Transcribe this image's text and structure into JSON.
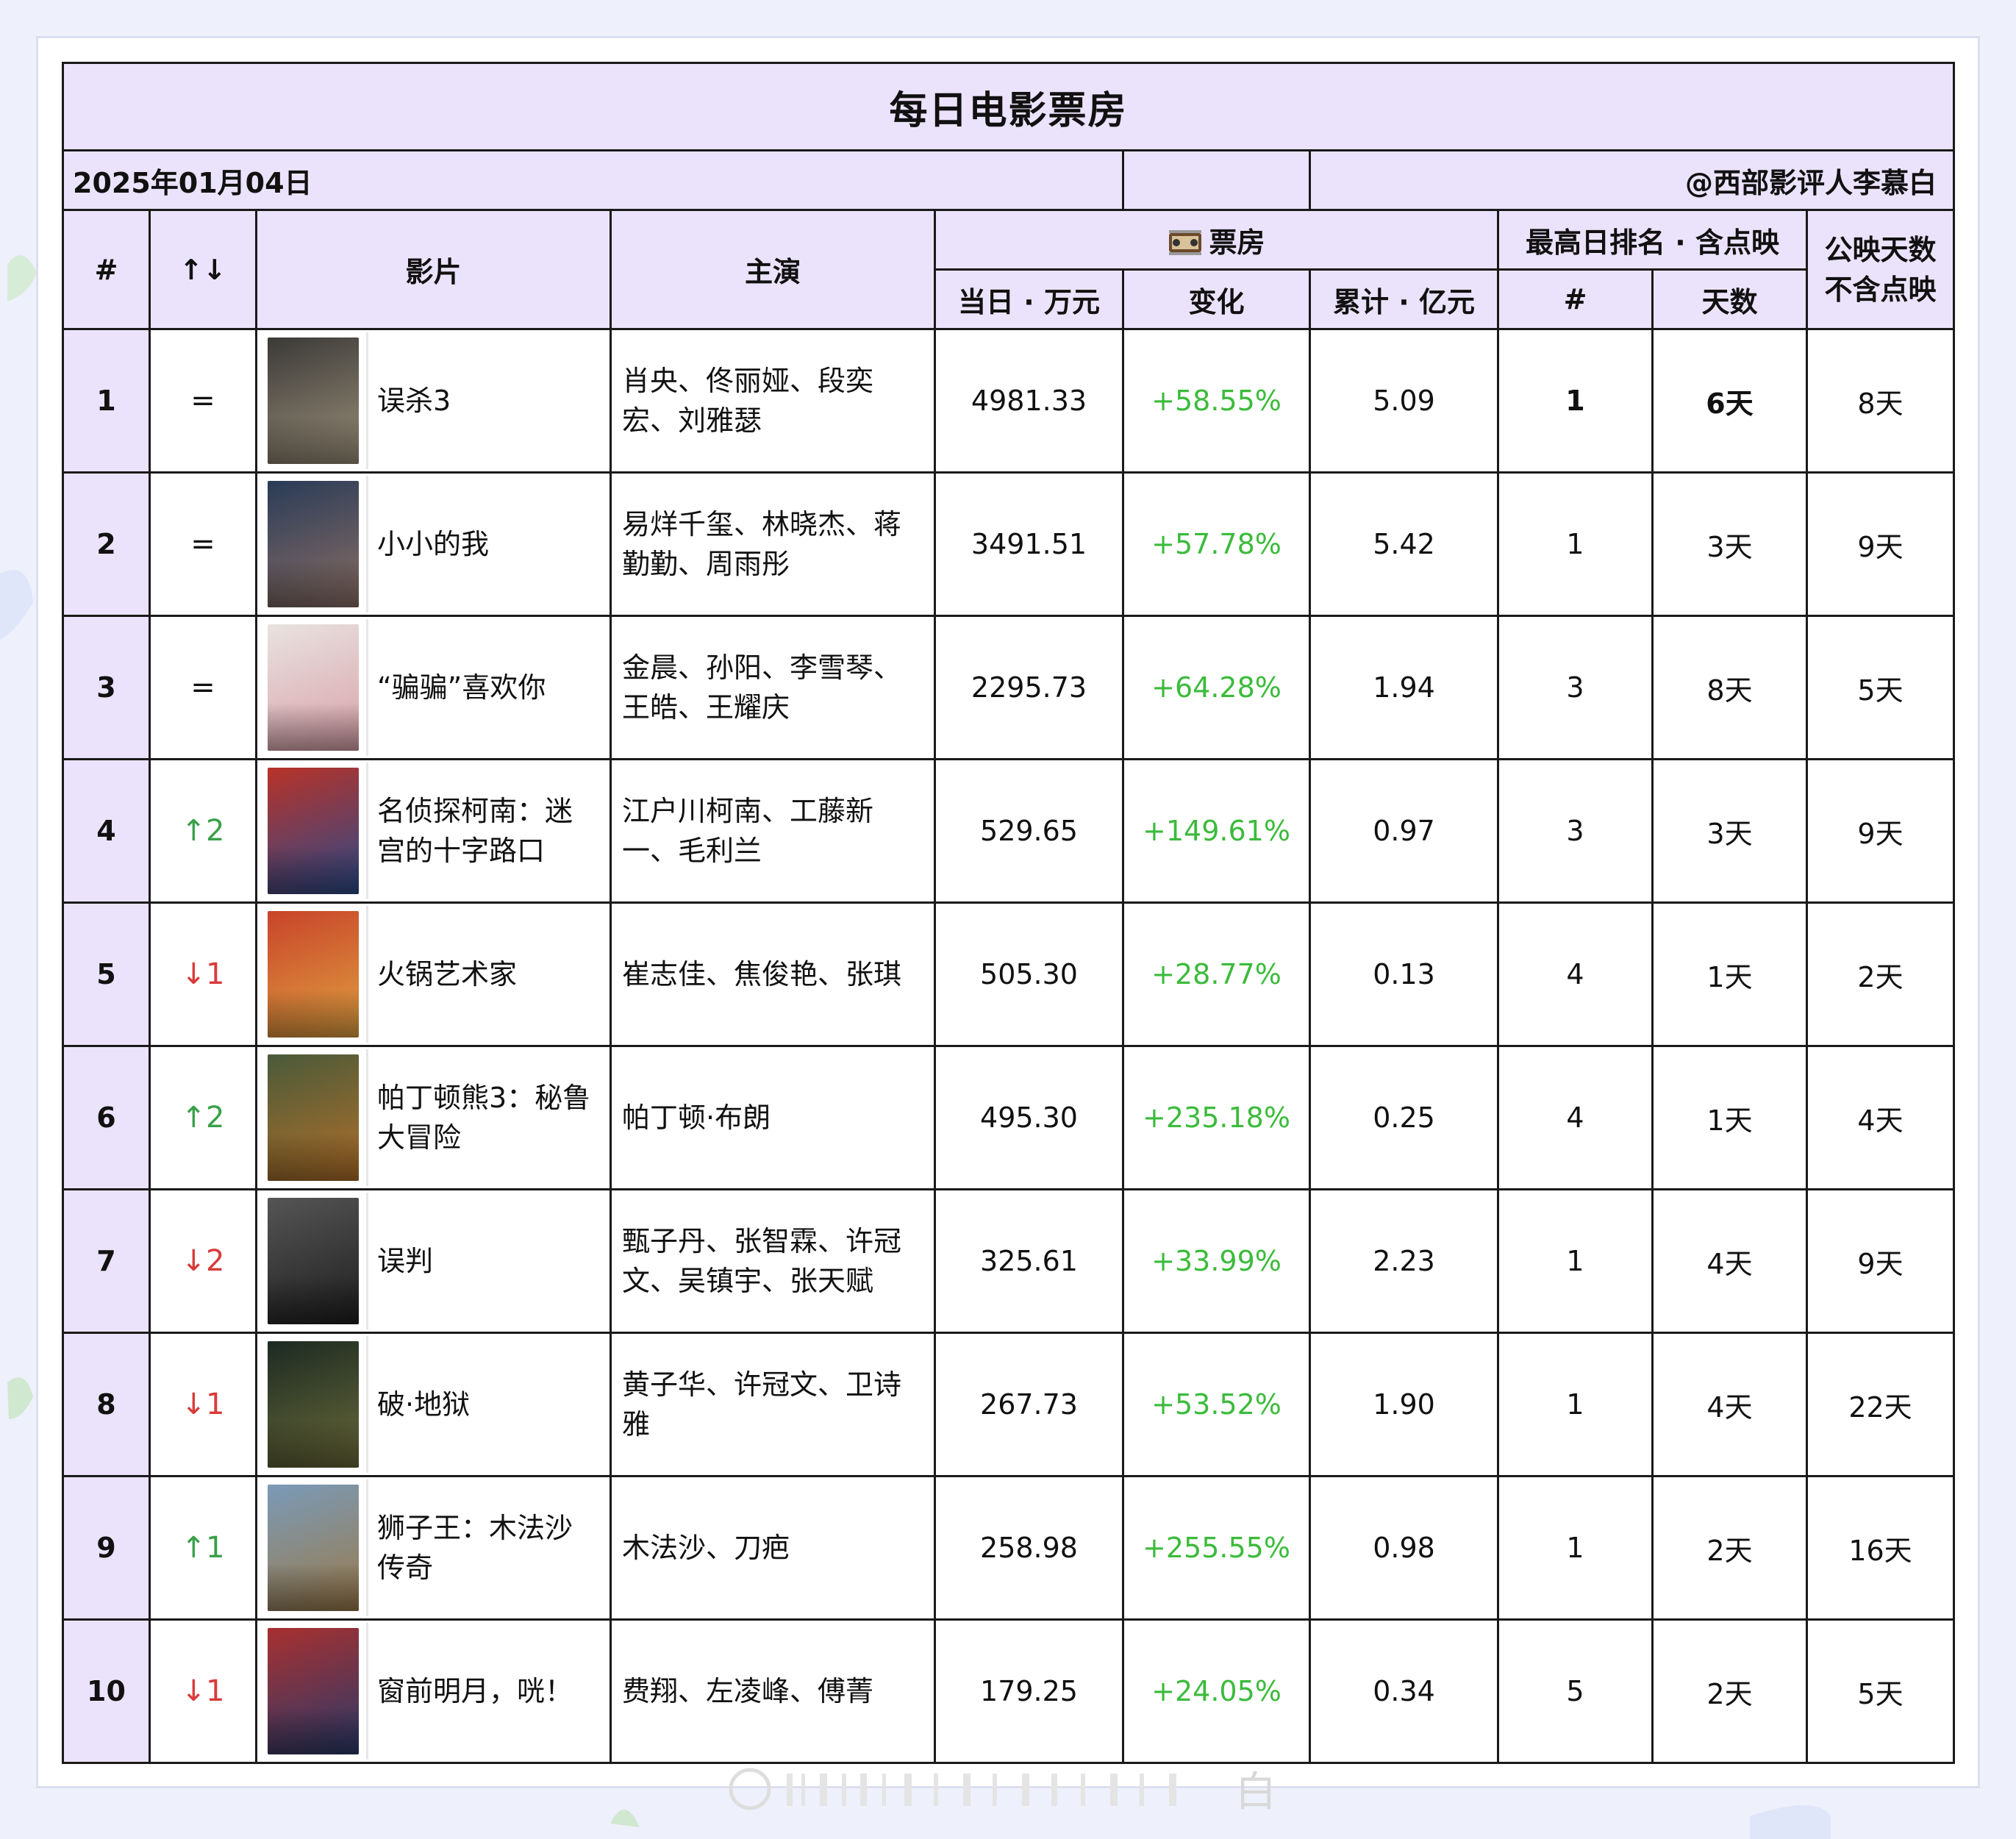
{
  "title": "每日电影票房",
  "date": "2025年01月04日",
  "author": "@西部影评人李慕白",
  "headers": {
    "rank": "#",
    "change": "↑↓",
    "movie": "影片",
    "cast": "主演",
    "box_office_group": "票房",
    "box_office_icon": "film-reel-icon",
    "daily": "当日 · 万元",
    "delta": "变化",
    "total": "累计 · 亿元",
    "peak_group": "最高日排名 · 含点映",
    "peak_rank": "#",
    "peak_days": "天数",
    "release_days_line1": "公映天数",
    "release_days_line2": "不含点映"
  },
  "rows": [
    {
      "rank": "1",
      "change": "=",
      "trend": "eq",
      "movie_line1": "误杀3",
      "movie_line2": "",
      "cast_line1": "肖央、佟丽娅、段奕",
      "cast_line2": "宏、刘雅瑟",
      "daily": "4981.33",
      "delta": "+58.55%",
      "total": "5.09",
      "peak": "1",
      "peak_days": "6天",
      "release_days": "8天",
      "poster_colors": [
        "#3b3a38",
        "#9b8f7a"
      ]
    },
    {
      "rank": "2",
      "change": "=",
      "trend": "eq",
      "movie_line1": "小小的我",
      "movie_line2": "",
      "cast_line1": "易烊千玺、林晓杰、蒋",
      "cast_line2": "勤勤、周雨彤",
      "daily": "3491.51",
      "delta": "+57.78%",
      "total": "5.42",
      "peak": "1",
      "peak_days": "3天",
      "release_days": "9天",
      "poster_colors": [
        "#2a3b57",
        "#8a6f66"
      ]
    },
    {
      "rank": "3",
      "change": "=",
      "trend": "eq",
      "movie_line1": "“骗骗”喜欢你",
      "movie_line2": "",
      "cast_line1": "金晨、孙阳、李雪琴、",
      "cast_line2": "王皓、王耀庆",
      "daily": "2295.73",
      "delta": "+64.28%",
      "total": "1.94",
      "peak": "3",
      "peak_days": "8天",
      "release_days": "5天",
      "poster_colors": [
        "#e8e3e0",
        "#d8a0a8"
      ]
    },
    {
      "rank": "4",
      "change": "↑2",
      "trend": "up",
      "movie_line1": "名侦探柯南：迷",
      "movie_line2": "宫的十字路口",
      "cast_line1": "江户川柯南、工藤新",
      "cast_line2": "一、毛利兰",
      "daily": "529.65",
      "delta": "+149.61%",
      "total": "0.97",
      "peak": "3",
      "peak_days": "3天",
      "release_days": "9天",
      "poster_colors": [
        "#b83228",
        "#2c4a8a"
      ]
    },
    {
      "rank": "5",
      "change": "↓1",
      "trend": "down",
      "movie_line1": "火锅艺术家",
      "movie_line2": "",
      "cast_line1": "崔志佳、焦俊艳、张琪",
      "cast_line2": "",
      "daily": "505.30",
      "delta": "+28.77%",
      "total": "0.13",
      "peak": "4",
      "peak_days": "1天",
      "release_days": "2天",
      "poster_colors": [
        "#c8442a",
        "#e0a040"
      ]
    },
    {
      "rank": "6",
      "change": "↑2",
      "trend": "up",
      "movie_line1": "帕丁顿熊3：秘鲁",
      "movie_line2": "大冒险",
      "cast_line1": "帕丁顿·布朗",
      "cast_line2": "",
      "daily": "495.30",
      "delta": "+235.18%",
      "total": "0.25",
      "peak": "4",
      "peak_days": "1天",
      "release_days": "4天",
      "poster_colors": [
        "#4a5a3a",
        "#b0702a"
      ]
    },
    {
      "rank": "7",
      "change": "↓2",
      "trend": "down",
      "movie_line1": "误判",
      "movie_line2": "",
      "cast_line1": "甄子丹、张智霖、许冠",
      "cast_line2": "文、吴镇宇、张天赋",
      "daily": "325.61",
      "delta": "+33.99%",
      "total": "2.23",
      "peak": "1",
      "peak_days": "4天",
      "release_days": "9天",
      "poster_colors": [
        "#555555",
        "#1e1e1e"
      ]
    },
    {
      "rank": "8",
      "change": "↓1",
      "trend": "down",
      "movie_line1": "破·地狱",
      "movie_line2": "",
      "cast_line1": "黄子华、许冠文、卫诗",
      "cast_line2": "雅",
      "daily": "267.73",
      "delta": "+53.52%",
      "total": "1.90",
      "peak": "1",
      "peak_days": "4天",
      "release_days": "22天",
      "poster_colors": [
        "#1c2a22",
        "#6a6a3a"
      ]
    },
    {
      "rank": "9",
      "change": "↑1",
      "trend": "up",
      "movie_line1": "狮子王：木法沙",
      "movie_line2": "传奇",
      "cast_line1": "木法沙、刀疤",
      "cast_line2": "",
      "daily": "258.98",
      "delta": "+255.55%",
      "total": "0.98",
      "peak": "1",
      "peak_days": "2天",
      "release_days": "16天",
      "poster_colors": [
        "#7a9ab8",
        "#9a7a4a"
      ]
    },
    {
      "rank": "10",
      "change": "↓1",
      "trend": "down",
      "movie_line1": "窗前明月，咣！",
      "movie_line2": "",
      "cast_line1": "费翔、左凌峰、傅菁",
      "cast_line2": "",
      "daily": "179.25",
      "delta": "+24.05%",
      "total": "0.34",
      "peak": "5",
      "peak_days": "2天",
      "release_days": "5天",
      "poster_colors": [
        "#a83030",
        "#2a3a6a"
      ]
    }
  ],
  "watermark_text": "白"
}
